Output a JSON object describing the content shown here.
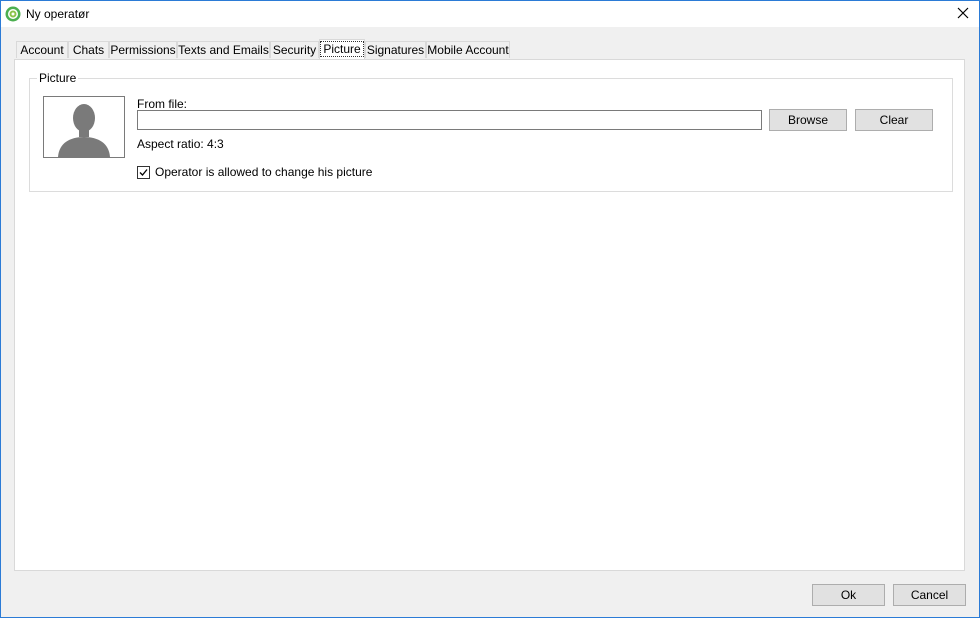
{
  "window": {
    "title": "Ny operatør",
    "app_icon": "gear-icon",
    "close_icon": "close-icon"
  },
  "tabs": [
    {
      "label": "Account"
    },
    {
      "label": "Chats"
    },
    {
      "label": "Permissions"
    },
    {
      "label": "Texts and Emails"
    },
    {
      "label": "Security"
    },
    {
      "label": "Picture",
      "active": true
    },
    {
      "label": "Signatures"
    },
    {
      "label": "Mobile Account"
    }
  ],
  "picture": {
    "group_title": "Picture",
    "avatar_icon": "person-silhouette-icon",
    "from_file_label": "From file:",
    "file_value": "",
    "browse_label": "Browse",
    "clear_label": "Clear",
    "aspect_text": "Aspect ratio: 4:3",
    "allow_change_label": "Operator is allowed to change his picture",
    "allow_change_checked": true
  },
  "footer": {
    "ok_label": "Ok",
    "cancel_label": "Cancel"
  },
  "colors": {
    "window_border": "#2b7bd6",
    "accent_green": "#5cb85c"
  }
}
